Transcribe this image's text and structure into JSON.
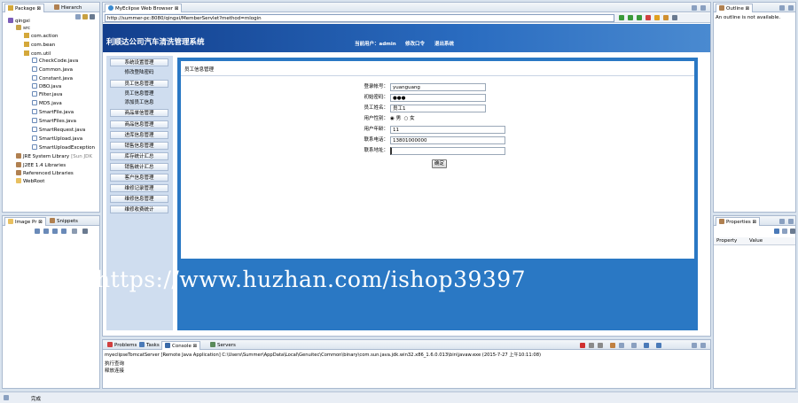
{
  "package_explorer": {
    "tabs": [
      "Package",
      "Hierarch"
    ],
    "tree": [
      {
        "label": "qingxi",
        "icon": "project-icon",
        "indent": 0
      },
      {
        "label": "src",
        "icon": "source-folder-icon",
        "indent": 1
      },
      {
        "label": "com.action",
        "icon": "package-icon",
        "indent": 2
      },
      {
        "label": "com.bean",
        "icon": "package-icon",
        "indent": 2
      },
      {
        "label": "com.util",
        "icon": "package-icon",
        "indent": 2
      },
      {
        "label": "CheckCode.java",
        "icon": "java-file-icon",
        "indent": 3
      },
      {
        "label": "Common.java",
        "icon": "java-file-icon",
        "indent": 3
      },
      {
        "label": "Constant.java",
        "icon": "java-file-icon",
        "indent": 3
      },
      {
        "label": "DBO.java",
        "icon": "java-file-icon",
        "indent": 3
      },
      {
        "label": "Filter.java",
        "icon": "java-file-icon",
        "indent": 3
      },
      {
        "label": "MD5.java",
        "icon": "java-file-icon",
        "indent": 3
      },
      {
        "label": "SmartFile.java",
        "icon": "java-file-icon",
        "indent": 3
      },
      {
        "label": "SmartFiles.java",
        "icon": "java-file-icon",
        "indent": 3
      },
      {
        "label": "SmartRequest.java",
        "icon": "java-file-icon",
        "indent": 3
      },
      {
        "label": "SmartUpload.java",
        "icon": "java-file-icon",
        "indent": 3
      },
      {
        "label": "SmartUploadException",
        "icon": "java-file-icon",
        "indent": 3
      },
      {
        "label": "JRE System Library",
        "suffix": "[Sun JDK",
        "icon": "library-icon",
        "indent": 1
      },
      {
        "label": "J2EE 1.4 Libraries",
        "icon": "library-icon",
        "indent": 1
      },
      {
        "label": "Referenced Libraries",
        "icon": "library-icon",
        "indent": 1
      },
      {
        "label": "WebRoot",
        "icon": "folder-icon",
        "indent": 1
      }
    ]
  },
  "image_preview": {
    "tabs": [
      "Image Pr",
      "Snippets"
    ]
  },
  "browser": {
    "tab": "MyEclipse Web Browser",
    "url": "http://summer-pc:8080/qingxi/MemberServlet?method=mlogin"
  },
  "webapp": {
    "title": "利顺达公司汽车清洗管理系统",
    "current_user_label": "当前用户：",
    "current_user": "admin",
    "change_password": "修改口令",
    "logout": "退出系统",
    "menu": [
      {
        "label": "系统设置管理",
        "type": "item"
      },
      {
        "label": "修改登陆密码",
        "type": "sub"
      },
      {
        "label": "员工信息管理",
        "type": "item"
      },
      {
        "label": "员工信息管理",
        "type": "sub"
      },
      {
        "label": "添加员工信息",
        "type": "sub"
      },
      {
        "label": "商品单信管理",
        "type": "item"
      },
      {
        "label": "商品信息管理",
        "type": "item"
      },
      {
        "label": "进库信息管理",
        "type": "item"
      },
      {
        "label": "销售信息管理",
        "type": "item"
      },
      {
        "label": "库存统计汇总",
        "type": "item"
      },
      {
        "label": "销售统计汇总",
        "type": "item"
      },
      {
        "label": "客户信息管理",
        "type": "item"
      },
      {
        "label": "维修记录管理",
        "type": "item"
      },
      {
        "label": "维修信息管理",
        "type": "item"
      },
      {
        "label": "维修收费统计",
        "type": "item"
      }
    ],
    "breadcrumb": "员工信息管理",
    "form": {
      "username_label": "登录帐号：",
      "username_value": "yuanguang",
      "password_label": "初始密码：",
      "password_value": "●●●",
      "realname_label": "员工姓名：",
      "realname_value": "员工1",
      "sex_label": "用户性别：",
      "sex_male": "男",
      "sex_female": "女",
      "age_label": "用户年龄：",
      "age_value": "11",
      "phone_label": "联系电话：",
      "phone_value": "13801000000",
      "address_label": "联系地址：",
      "address_value": "",
      "submit_label": "确定"
    }
  },
  "watermark": "https://www.huzhan.com/ishop39397",
  "outline": {
    "tab": "Outline",
    "message": "An outline is not available."
  },
  "properties": {
    "tab": "Properties",
    "col_property": "Property",
    "col_value": "Value"
  },
  "console": {
    "tabs": [
      "Problems",
      "Tasks",
      "Console",
      "Servers"
    ],
    "header": "myeclipseTomcatServer [Remote Java Application] C:\\Users\\Summer\\AppData\\Local\\Genuitec\\Common\\binary\\com.sun.java.jdk.win32.x86_1.6.0.013\\bin\\javaw.exe (2015-7-27 上午10:11:08)",
    "lines": [
      "执行查询",
      "释放连接"
    ]
  },
  "status_bar": {
    "text": "完成"
  }
}
